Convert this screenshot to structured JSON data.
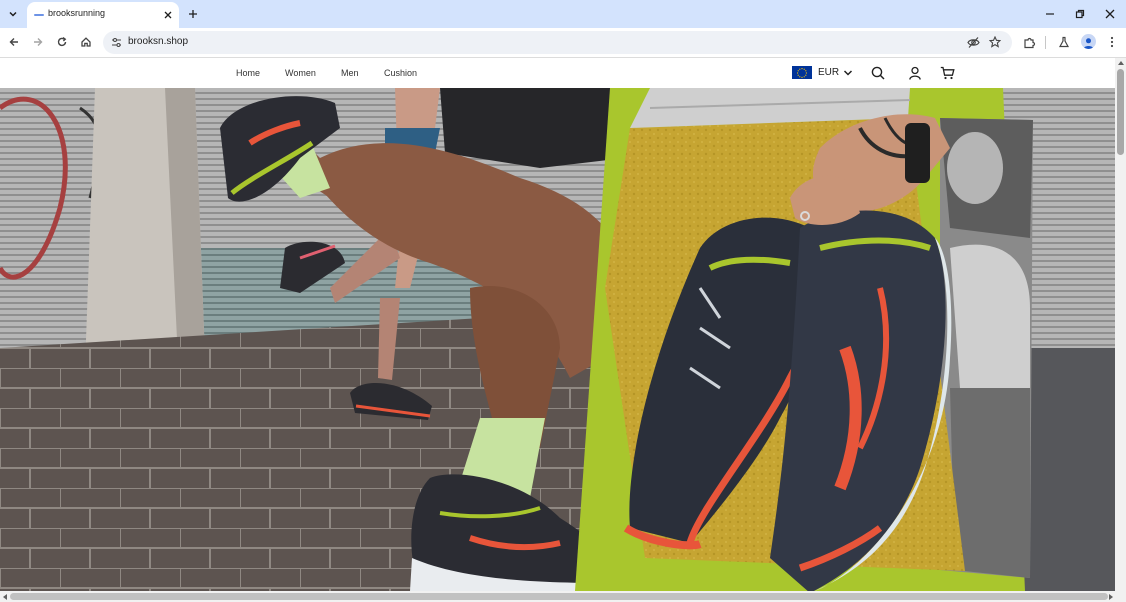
{
  "browser": {
    "tab_title": "brooksrunning",
    "url": "brooksn.shop",
    "icons": {
      "tab_list": "chevron-down-icon",
      "tab_close": "close-icon",
      "new_tab": "plus-icon",
      "minimize": "minimize-icon",
      "restore": "restore-icon",
      "close_window": "close-icon",
      "back": "arrow-left-icon",
      "forward": "arrow-right-icon",
      "reload": "reload-icon",
      "home": "home-icon",
      "site_info": "tune-icon",
      "eye_off": "eye-off-icon",
      "bookmark": "star-icon",
      "extensions": "puzzle-icon",
      "labs": "flask-icon",
      "profile": "person-icon",
      "menu": "kebab-icon"
    }
  },
  "site": {
    "nav": [
      "Home",
      "Women",
      "Men",
      "Cushion"
    ],
    "currency": {
      "code": "EUR",
      "flag": "eu-flag-icon"
    },
    "icons": {
      "search": "search-icon",
      "account": "user-icon",
      "cart": "cart-icon"
    }
  },
  "colors": {
    "tab_strip": "#d3e3fd",
    "omnibox": "#eef1f6",
    "eu_blue": "#003399",
    "eu_star": "#ffcc00",
    "shoe_accent": "#e8553a",
    "shoe_lime": "#a9c62d",
    "wall_yellow": "#c6a532"
  }
}
